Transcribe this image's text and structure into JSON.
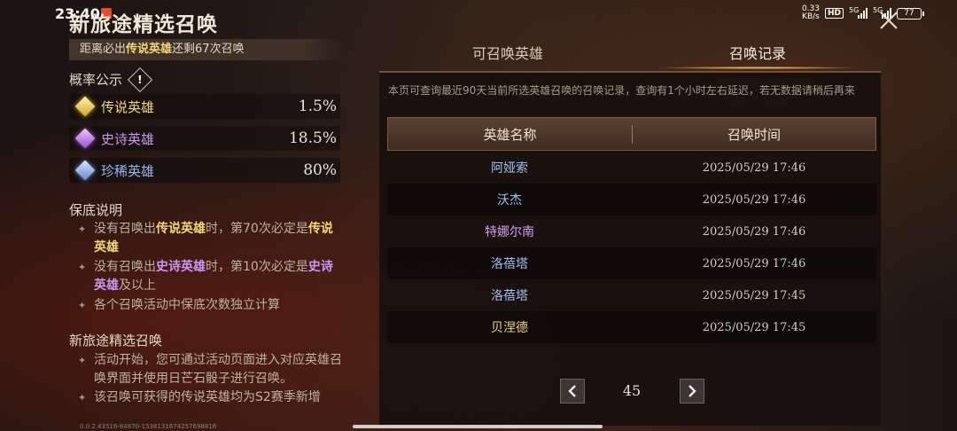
{
  "status_bar": {
    "time": "23:40",
    "net_speed_value": "0.33",
    "net_speed_unit": "KB/s",
    "hd_label": "HD",
    "signal1": "5G",
    "signal2": "5G",
    "battery": "77"
  },
  "left": {
    "title": "新旅途精选召唤",
    "remain_prefix": "距离必出",
    "remain_highlight": "传说英雄",
    "remain_suffix": "还剩67次召唤",
    "prob_title": "概率公示",
    "info_symbol": "!",
    "rates": [
      {
        "name": "传说英雄",
        "value": "1.5%",
        "tier": "leg"
      },
      {
        "name": "史诗英雄",
        "value": "18.5%",
        "tier": "epic"
      },
      {
        "name": "珍稀英雄",
        "value": "80%",
        "tier": "rare"
      }
    ],
    "pity_title": "保底说明",
    "pity": {
      "b1_pre": "没有召唤出",
      "b1_hl": "传说英雄",
      "b1_mid": "时，第70次必定是",
      "b1_hl2": "传说英雄",
      "b2_pre": "没有召唤出",
      "b2_hl": "史诗英雄",
      "b2_mid": "时，第10次必定是",
      "b2_hl2": "史诗英雄",
      "b2_post": "及以上",
      "b3": "各个召唤活动中保底次数独立计算"
    },
    "event_title": "新旅途精选召唤",
    "event_b1": "活动开始，您可通过活动页面进入对应英雄召唤界面并使用日芒石骰子进行召唤。",
    "event_b2": "该召唤可获得的传说英雄均为S2赛季新增",
    "footer_id": "0.0.2.43516-64870-1538131674257698816"
  },
  "right": {
    "tabs": [
      "可召唤英雄",
      "召唤记录"
    ],
    "notice": "本页可查询最近90天当前所选英雄召唤的召唤记录，查询有1个小时左右延迟，若无数据请稍后再来",
    "columns": [
      "英雄名称",
      "召唤时间"
    ],
    "records": [
      {
        "hero": "阿娅索",
        "time": "2025/05/29 17:46",
        "tier": "rare"
      },
      {
        "hero": "沃杰",
        "time": "2025/05/29 17:46",
        "tier": "rare"
      },
      {
        "hero": "特娜尔南",
        "time": "2025/05/29 17:46",
        "tier": "epic"
      },
      {
        "hero": "洛蓓塔",
        "time": "2025/05/29 17:46",
        "tier": "rare"
      },
      {
        "hero": "洛蓓塔",
        "time": "2025/05/29 17:45",
        "tier": "rare"
      },
      {
        "hero": "贝涅德",
        "time": "2025/05/29 17:45",
        "tier": "leg"
      }
    ],
    "page": "45"
  }
}
